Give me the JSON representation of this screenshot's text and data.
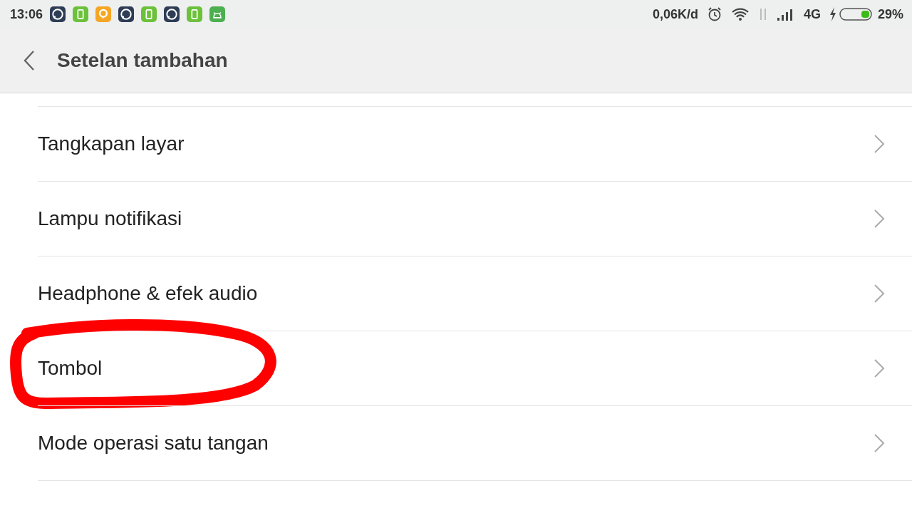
{
  "status_bar": {
    "time": "13:06",
    "notifications": [
      {
        "kind": "chat-bubble"
      },
      {
        "kind": "phone"
      },
      {
        "kind": "speech"
      },
      {
        "kind": "chat-bubble"
      },
      {
        "kind": "phone"
      },
      {
        "kind": "chat-bubble"
      },
      {
        "kind": "phone"
      },
      {
        "kind": "robot"
      }
    ],
    "speed": "0,06K/d",
    "network": "4G",
    "battery": {
      "level": 0.29,
      "charging": true
    },
    "battery_text": "29%"
  },
  "header": {
    "title": "Setelan tambahan"
  },
  "items": [
    {
      "label": "Tangkapan layar",
      "circled": false
    },
    {
      "label": "Lampu notifikasi",
      "circled": false
    },
    {
      "label": "Headphone & efek audio",
      "circled": false
    },
    {
      "label": "Tombol",
      "circled": true
    },
    {
      "label": "Mode operasi satu tangan",
      "circled": false
    }
  ]
}
